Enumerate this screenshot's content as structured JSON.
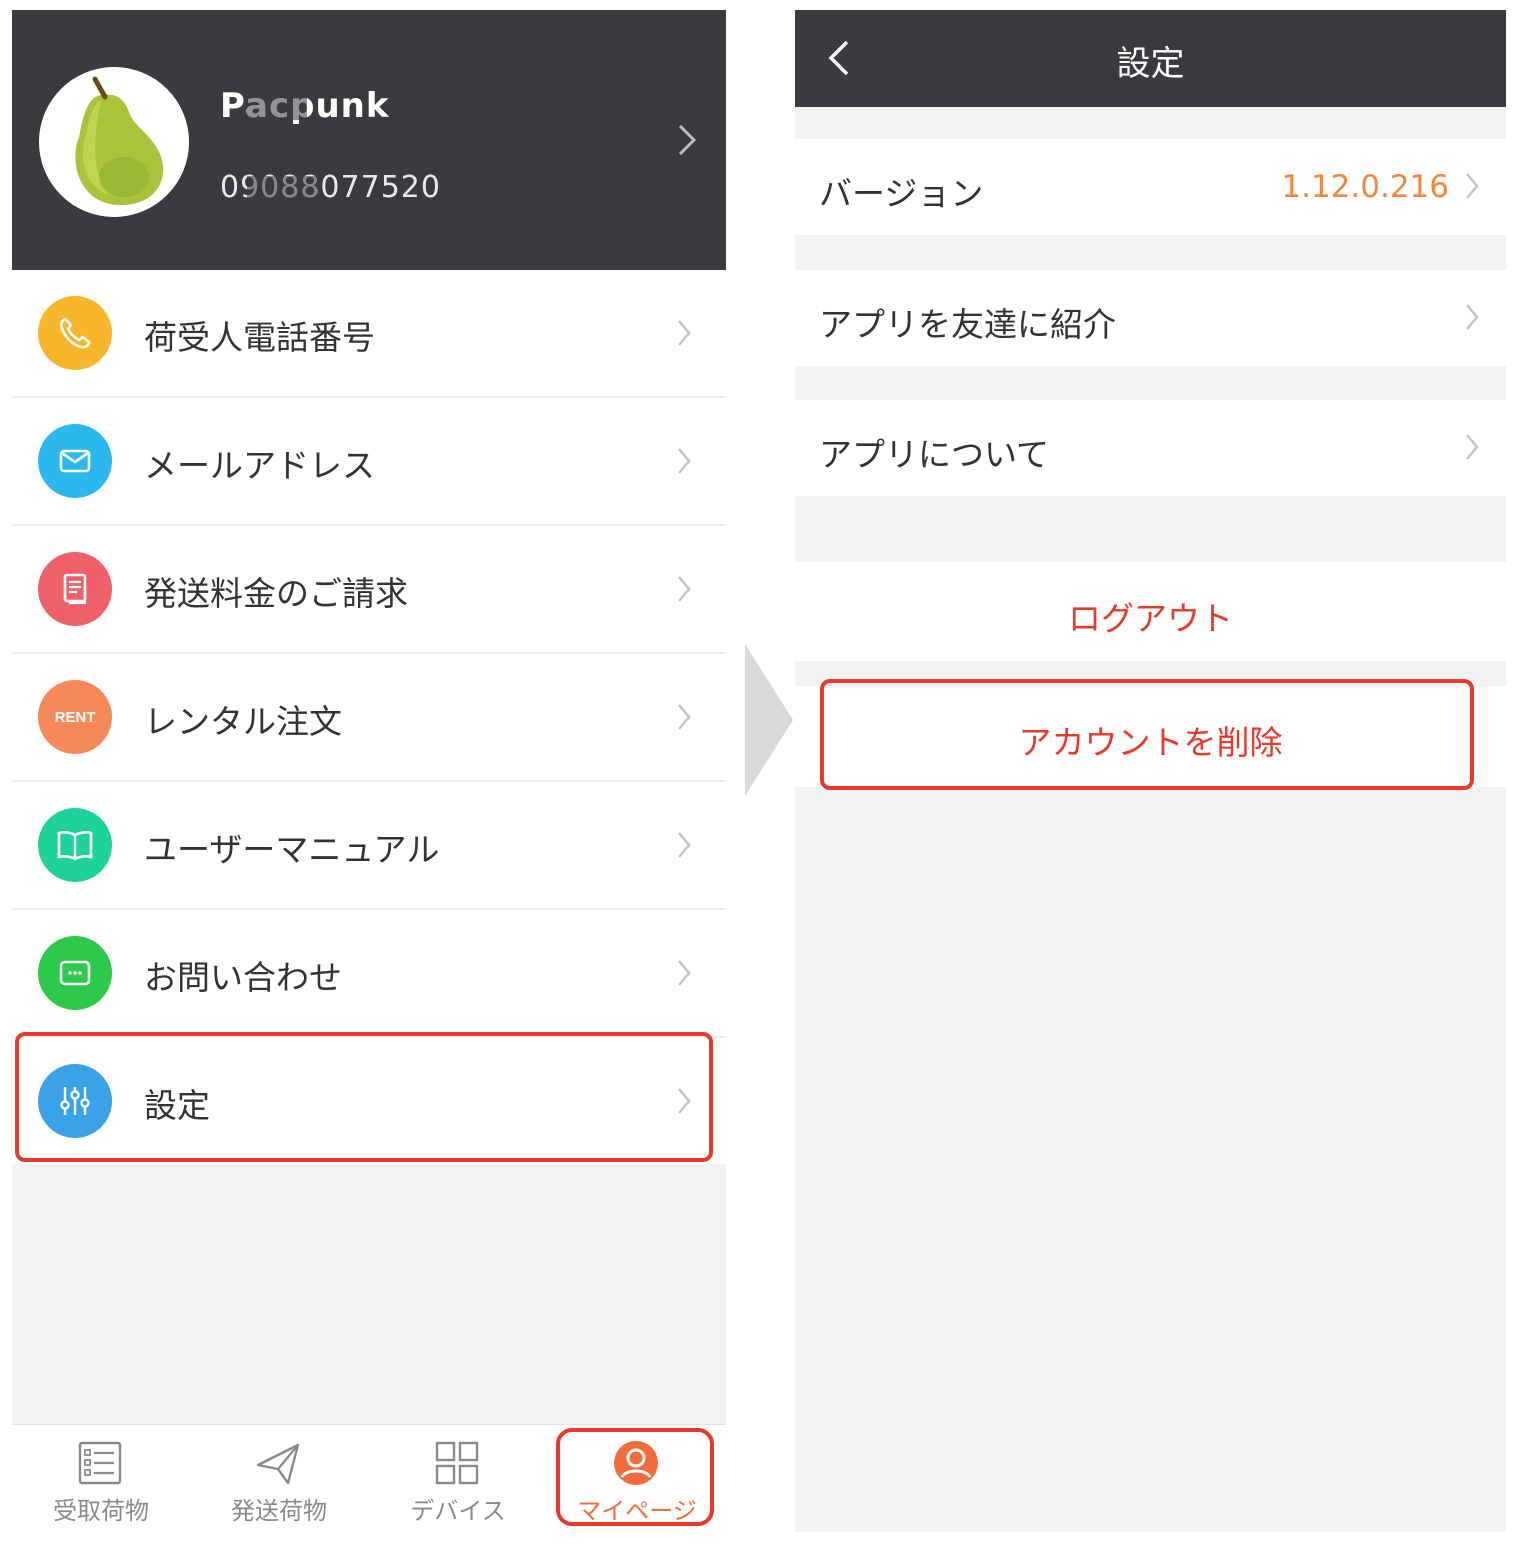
{
  "left_screen": {
    "profile": {
      "name": "Pacpunk",
      "phone": "09088077520"
    },
    "menu": [
      {
        "label": "荷受人電話番号",
        "icon": "phone-icon",
        "color": "#f8b62a"
      },
      {
        "label": "メールアドレス",
        "icon": "mail-icon",
        "color": "#2cb8ef"
      },
      {
        "label": "発送料金のご請求",
        "icon": "invoice-icon",
        "color": "#f0606a"
      },
      {
        "label": "レンタル注文",
        "icon": "rent-icon",
        "icon_text": "RENT",
        "color": "#f5895a"
      },
      {
        "label": "ユーザーマニュアル",
        "icon": "book-icon",
        "color": "#1fd29a"
      },
      {
        "label": "お問い合わせ",
        "icon": "chat-icon",
        "color": "#2cc94a"
      },
      {
        "label": "設定",
        "icon": "settings-sliders-icon",
        "color": "#3aa3e8"
      }
    ],
    "tabs": [
      {
        "label": "受取荷物",
        "icon": "list-icon",
        "active": false
      },
      {
        "label": "発送荷物",
        "icon": "send-icon",
        "active": false
      },
      {
        "label": "デバイス",
        "icon": "grid-icon",
        "active": false
      },
      {
        "label": "マイページ",
        "icon": "user-icon",
        "active": true
      }
    ]
  },
  "right_screen": {
    "title": "設定",
    "rows": [
      {
        "label": "バージョン",
        "value": "1.12.0.216"
      },
      {
        "label": "アプリを友達に紹介"
      },
      {
        "label": "アプリについて"
      }
    ],
    "logout_label": "ログアウト",
    "delete_account_label": "アカウントを削除"
  },
  "colors": {
    "header_bg": "#3a3b3f",
    "accent_orange": "#f26b3a",
    "highlight_red": "#e8392d",
    "version_orange": "#f0883e"
  }
}
